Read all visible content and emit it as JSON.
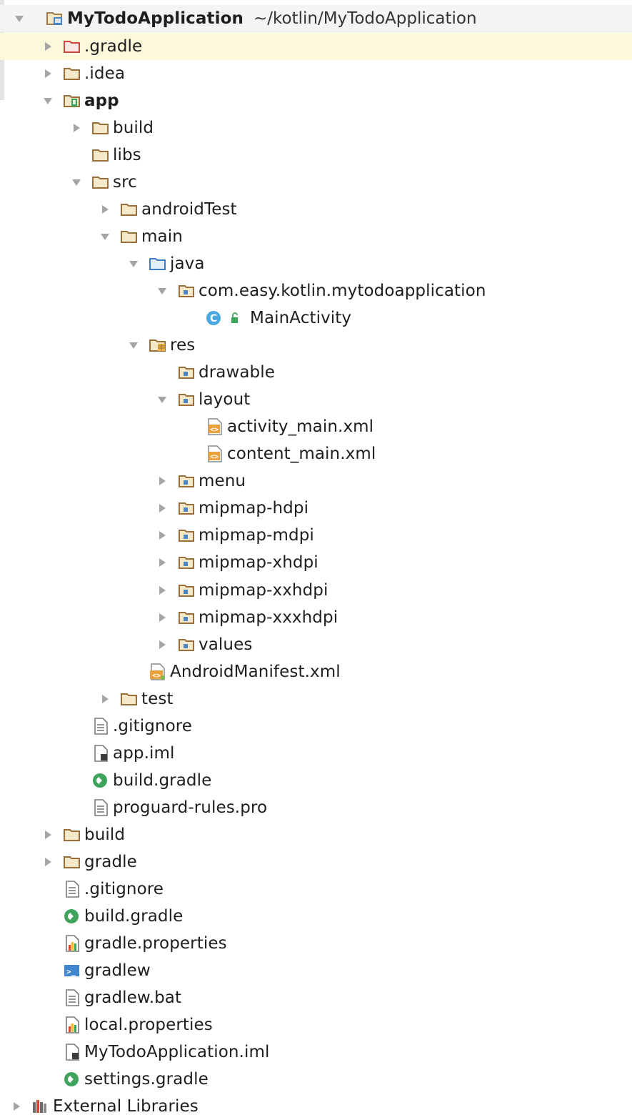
{
  "project_tree": {
    "root": {
      "label": "MyTodoApplication",
      "path": "~/kotlin/MyTodoApplication"
    },
    "nodes": [
      {
        "label": ".gradle",
        "icon": "folder-excluded-icon",
        "arrow": "collapsed",
        "depth": 1
      },
      {
        "label": ".idea",
        "icon": "folder-icon",
        "arrow": "collapsed",
        "depth": 1
      },
      {
        "label": "app",
        "icon": "module-folder-icon",
        "arrow": "expanded",
        "depth": 1
      },
      {
        "label": "build",
        "icon": "folder-icon",
        "arrow": "collapsed",
        "depth": 2
      },
      {
        "label": "libs",
        "icon": "folder-icon",
        "arrow": "none",
        "depth": 2
      },
      {
        "label": "src",
        "icon": "folder-icon",
        "arrow": "expanded",
        "depth": 2
      },
      {
        "label": "androidTest",
        "icon": "folder-icon",
        "arrow": "collapsed",
        "depth": 3
      },
      {
        "label": "main",
        "icon": "folder-icon",
        "arrow": "expanded",
        "depth": 3
      },
      {
        "label": "java",
        "icon": "source-folder-icon",
        "arrow": "expanded",
        "depth": 4
      },
      {
        "label": "com.easy.kotlin.mytodoapplication",
        "icon": "package-icon",
        "arrow": "expanded",
        "depth": 5
      },
      {
        "label": "MainActivity",
        "icon": "kotlin-class-icon",
        "arrow": "none",
        "depth": 6
      },
      {
        "label": "res",
        "icon": "resource-folder-icon",
        "arrow": "expanded",
        "depth": 4
      },
      {
        "label": "drawable",
        "icon": "package-icon",
        "arrow": "none",
        "depth": 5
      },
      {
        "label": "layout",
        "icon": "package-icon",
        "arrow": "expanded",
        "depth": 5
      },
      {
        "label": "activity_main.xml",
        "icon": "xml-file-icon",
        "arrow": "none",
        "depth": 6
      },
      {
        "label": "content_main.xml",
        "icon": "xml-file-icon",
        "arrow": "none",
        "depth": 6
      },
      {
        "label": "menu",
        "icon": "package-icon",
        "arrow": "collapsed",
        "depth": 5
      },
      {
        "label": "mipmap-hdpi",
        "icon": "package-icon",
        "arrow": "collapsed",
        "depth": 5
      },
      {
        "label": "mipmap-mdpi",
        "icon": "package-icon",
        "arrow": "collapsed",
        "depth": 5
      },
      {
        "label": "mipmap-xhdpi",
        "icon": "package-icon",
        "arrow": "collapsed",
        "depth": 5
      },
      {
        "label": "mipmap-xxhdpi",
        "icon": "package-icon",
        "arrow": "collapsed",
        "depth": 5
      },
      {
        "label": "mipmap-xxxhdpi",
        "icon": "package-icon",
        "arrow": "collapsed",
        "depth": 5
      },
      {
        "label": "values",
        "icon": "package-icon",
        "arrow": "collapsed",
        "depth": 5
      },
      {
        "label": "AndroidManifest.xml",
        "icon": "manifest-icon",
        "arrow": "none",
        "depth": 4
      },
      {
        "label": "test",
        "icon": "folder-icon",
        "arrow": "collapsed",
        "depth": 3
      },
      {
        "label": ".gitignore",
        "icon": "text-file-icon",
        "arrow": "none",
        "depth": 2
      },
      {
        "label": "app.iml",
        "icon": "iml-file-icon",
        "arrow": "none",
        "depth": 2
      },
      {
        "label": "build.gradle",
        "icon": "gradle-file-icon",
        "arrow": "none",
        "depth": 2
      },
      {
        "label": "proguard-rules.pro",
        "icon": "text-file-icon",
        "arrow": "none",
        "depth": 2
      },
      {
        "label": "build",
        "icon": "folder-icon",
        "arrow": "collapsed",
        "depth": 1
      },
      {
        "label": "gradle",
        "icon": "folder-icon",
        "arrow": "collapsed",
        "depth": 1
      },
      {
        "label": ".gitignore",
        "icon": "text-file-icon",
        "arrow": "none",
        "depth": 1
      },
      {
        "label": "build.gradle",
        "icon": "gradle-file-icon",
        "arrow": "none",
        "depth": 1
      },
      {
        "label": "gradle.properties",
        "icon": "properties-file-icon",
        "arrow": "none",
        "depth": 1
      },
      {
        "label": "gradlew",
        "icon": "shell-script-icon",
        "arrow": "none",
        "depth": 1
      },
      {
        "label": "gradlew.bat",
        "icon": "text-file-icon",
        "arrow": "none",
        "depth": 1
      },
      {
        "label": "local.properties",
        "icon": "properties-file-icon",
        "arrow": "none",
        "depth": 1
      },
      {
        "label": "MyTodoApplication.iml",
        "icon": "iml-file-icon",
        "arrow": "none",
        "depth": 1
      },
      {
        "label": "settings.gradle",
        "icon": "gradle-file-icon",
        "arrow": "none",
        "depth": 1
      },
      {
        "label": "External Libraries",
        "icon": "library-icon",
        "arrow": "collapsed",
        "depth": 0
      }
    ]
  },
  "colors": {
    "folder": "#9a6f3a",
    "folder_fill": "#f6e9c9",
    "excluded_folder": "#d0473f",
    "source_folder": "#3e7fc4",
    "package_dot": "#4b86c5",
    "xml_orange": "#e9a23b",
    "gradle_green": "#3ea35b",
    "selected_row": "#fbf8dc",
    "arrow": "#a5a5a5",
    "text": "#1e1e1e"
  }
}
